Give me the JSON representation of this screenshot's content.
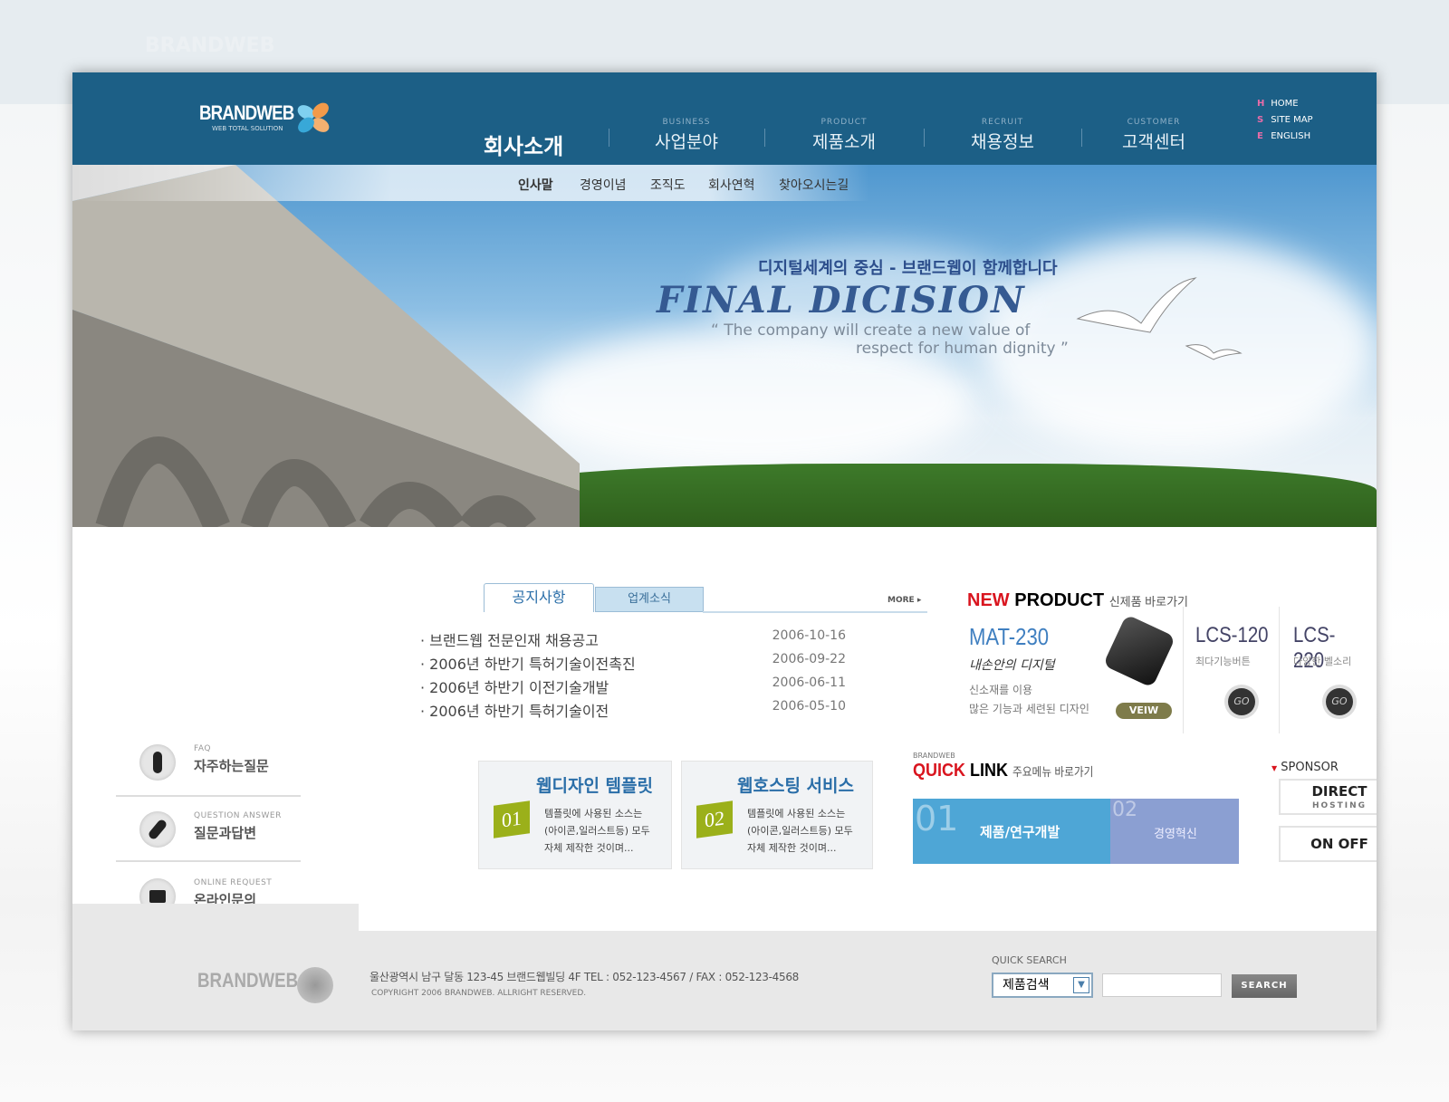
{
  "brand": {
    "name": "BRANDWEB",
    "tagline": "WEB TOTAL SOLUTION"
  },
  "gnb": [
    {
      "en": "",
      "ko": "회사소개",
      "active": true
    },
    {
      "en": "BUSINESS",
      "ko": "사업분야"
    },
    {
      "en": "PRODUCT",
      "ko": "제품소개"
    },
    {
      "en": "RECRUIT",
      "ko": "채용정보"
    },
    {
      "en": "CUSTOMER",
      "ko": "고객센터"
    }
  ],
  "util": [
    {
      "badge": "H",
      "label": "HOME"
    },
    {
      "badge": "S",
      "label": "SITE MAP"
    },
    {
      "badge": "E",
      "label": "ENGLISH"
    }
  ],
  "snb": [
    "인사말",
    "경영이념",
    "조직도",
    "회사연혁",
    "찾아오시는길"
  ],
  "hero": {
    "headline": "디지털세계의 중심 - 브랜드웹이 함께합니다",
    "script": "FINAL DICISION",
    "quote1": "“ The company will create a new value of",
    "quote2": "respect for human dignity ”"
  },
  "side_menu": [
    {
      "en": "FAQ",
      "ko": "자주하는질문",
      "icon": "microphone-icon"
    },
    {
      "en": "QUESTION ANSWER",
      "ko": "질문과답변",
      "icon": "pen-icon"
    },
    {
      "en": "ONLINE REQUEST",
      "ko": "온라인문의",
      "icon": "monitor-icon"
    }
  ],
  "notice": {
    "tabs": [
      "공지사항",
      "업계소식"
    ],
    "more": "MORE",
    "items": [
      {
        "title": "브랜드웹 전문인재 채용공고",
        "date": "2006-10-16"
      },
      {
        "title": "2006년 하반기 특허기술이전촉진",
        "date": "2006-09-22"
      },
      {
        "title": "2006년 하반기 이전기술개발",
        "date": "2006-06-11"
      },
      {
        "title": "2006년 하반기 특허기술이전",
        "date": "2006-05-10"
      }
    ]
  },
  "new_product": {
    "title_red": "NEW",
    "title_black": "PRODUCT",
    "subtitle": "신제품 바로가기",
    "main": {
      "name": "MAT-230",
      "script": "내손안의 디지털",
      "desc1": "신소재를 이용",
      "desc2": "많은 기능과 세련된 디자인",
      "button": "VEIW"
    },
    "others": [
      {
        "name": "LCS-120",
        "desc": "최다기능버튼",
        "button": "GO"
      },
      {
        "name": "LCS-220",
        "desc": "다양한 벨소리",
        "button": "GO"
      }
    ]
  },
  "boxes": [
    {
      "num": "01",
      "title": "웹디자인 템플릿",
      "lines": [
        "템플릿에 사용된 소스는",
        "(아이콘,일러스트등) 모두",
        "자체 제작한 것이며..."
      ]
    },
    {
      "num": "02",
      "title": "웹호스팅 서비스",
      "lines": [
        "템플릿에 사용된 소스는",
        "(아이콘,일러스트등) 모두",
        "자체 제작한 것이며..."
      ]
    }
  ],
  "quick_link": {
    "small": "BRANDWEB",
    "red": "QUICK",
    "black": "LINK",
    "sub": "주요메뉴 바로가기",
    "items": [
      {
        "num": "01",
        "label": "제품/연구개발"
      },
      {
        "num": "02",
        "label": "경영혁신"
      }
    ]
  },
  "sponsor": {
    "title": "SPONSOR",
    "items": [
      "DIRECT",
      "ON OFF"
    ],
    "direct_sub": "HOSTING"
  },
  "footer": {
    "address": "울산광역시 남구 달동 123-45 브랜드웹빌딩 4F   TEL : 052-123-4567  /  FAX : 052-123-4568",
    "copyright": "COPYRIGHT 2006 BRANDWEB. ALLRIGHT RESERVED.",
    "search_label": "QUICK SEARCH",
    "select_value": "제품검색",
    "search_button": "SEARCH"
  },
  "colors": {
    "header": "#1c5f86",
    "accent_red": "#d9151f",
    "quick_blue": "#4ea6d6",
    "quick_purple": "#8b9fd2",
    "badge_green": "#9bb01a"
  }
}
